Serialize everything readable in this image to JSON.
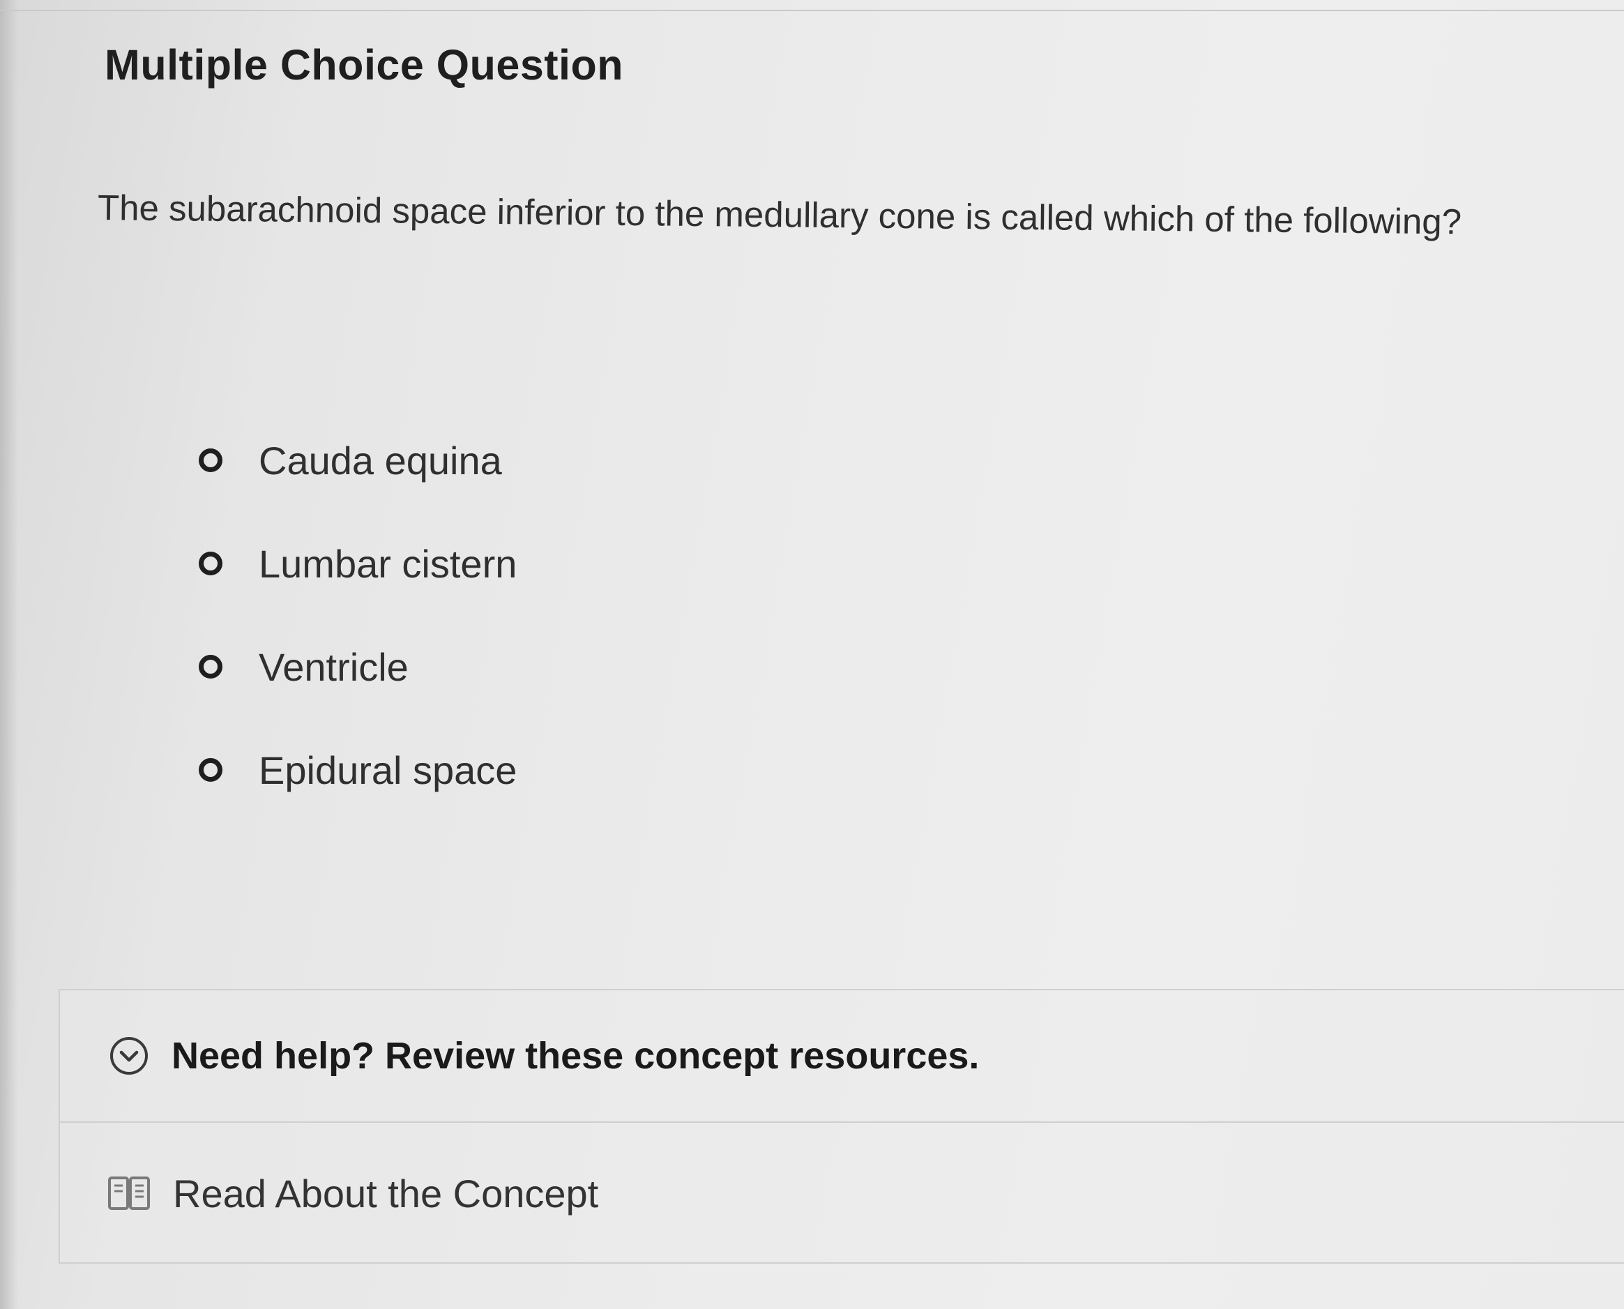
{
  "question": {
    "type_label": "Multiple Choice Question",
    "text": "The subarachnoid space inferior to the medullary cone is called which of the following?",
    "options": [
      {
        "label": "Cauda equina",
        "selected": false
      },
      {
        "label": "Lumbar cistern",
        "selected": false
      },
      {
        "label": "Ventricle",
        "selected": false
      },
      {
        "label": "Epidural space",
        "selected": false
      }
    ]
  },
  "help": {
    "title": "Need help? Review these concept resources.",
    "toggle_icon": "chevron-down-circle-icon",
    "resources": [
      {
        "label": "Read About the Concept",
        "icon": "book-icon"
      }
    ]
  },
  "colors": {
    "text_dark": "#1f1f1f",
    "text": "#2f2f2f",
    "border": "#cfcfcf",
    "background": "#ebebeb"
  }
}
